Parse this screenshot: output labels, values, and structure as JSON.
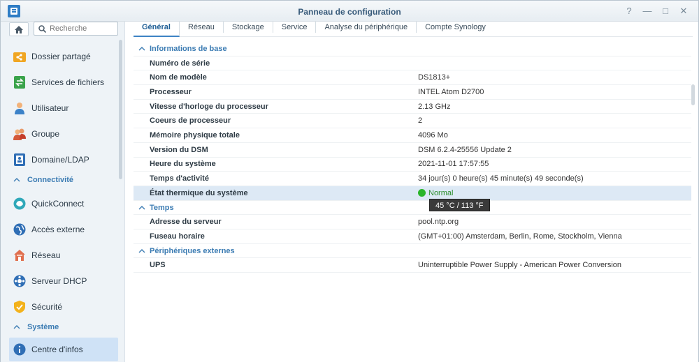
{
  "window": {
    "title": "Panneau de configuration",
    "buttons": {
      "help": "?",
      "minimize": "—",
      "maximize": "□",
      "close": "✕"
    }
  },
  "sidebar": {
    "search_placeholder": "Recherche",
    "items": [
      {
        "label": "Dossier partagé",
        "icon": "shared-folder-icon"
      },
      {
        "label": "Services de fichiers",
        "icon": "file-services-icon"
      },
      {
        "label": "Utilisateur",
        "icon": "user-icon"
      },
      {
        "label": "Groupe",
        "icon": "group-icon"
      },
      {
        "label": "Domaine/LDAP",
        "icon": "domain-icon"
      }
    ],
    "sections": [
      {
        "label": "Connectivité",
        "items": [
          {
            "label": "QuickConnect",
            "icon": "quickconnect-icon"
          },
          {
            "label": "Accès externe",
            "icon": "external-access-icon"
          },
          {
            "label": "Réseau",
            "icon": "network-icon"
          },
          {
            "label": "Serveur DHCP",
            "icon": "dhcp-icon"
          },
          {
            "label": "Sécurité",
            "icon": "security-icon"
          }
        ]
      },
      {
        "label": "Système",
        "items": [
          {
            "label": "Centre d'infos",
            "icon": "info-icon",
            "active": true
          }
        ]
      }
    ]
  },
  "tabs": [
    {
      "label": "Général",
      "active": true
    },
    {
      "label": "Réseau"
    },
    {
      "label": "Stockage"
    },
    {
      "label": "Service"
    },
    {
      "label": "Analyse du périphérique"
    },
    {
      "label": "Compte Synology"
    }
  ],
  "groups": [
    {
      "title": "Informations de base",
      "rows": [
        {
          "key": "Numéro de série",
          "value": ""
        },
        {
          "key": "Nom de modèle",
          "value": "DS1813+"
        },
        {
          "key": "Processeur",
          "value": "INTEL Atom D2700"
        },
        {
          "key": "Vitesse d'horloge du processeur",
          "value": "2.13 GHz"
        },
        {
          "key": "Coeurs de processeur",
          "value": "2"
        },
        {
          "key": "Mémoire physique totale",
          "value": "4096 Mo"
        },
        {
          "key": "Version du DSM",
          "value": "DSM 6.2.4-25556 Update 2"
        },
        {
          "key": "Heure du système",
          "value": "2021-11-01 17:57:55"
        },
        {
          "key": "Temps d'activité",
          "value": "34 jour(s) 0 heure(s) 45 minute(s) 49 seconde(s)"
        },
        {
          "key": "État thermique du système",
          "value": "Normal",
          "status": "ok"
        }
      ]
    },
    {
      "title": "Temps",
      "rows": [
        {
          "key": "Adresse du serveur",
          "value": "pool.ntp.org"
        },
        {
          "key": "Fuseau horaire",
          "value": "(GMT+01:00) Amsterdam, Berlin, Rome, Stockholm, Vienna"
        }
      ]
    },
    {
      "title": "Périphériques externes",
      "rows": [
        {
          "key": "UPS",
          "value": "Uninterruptible Power Supply - American Power Conversion"
        }
      ]
    }
  ],
  "tooltip": {
    "text": "45 °C / 113 °F"
  },
  "colors": {
    "accent": "#3c7cb3",
    "status_ok": "#2ab52a",
    "highlight": "#dde9f5"
  }
}
